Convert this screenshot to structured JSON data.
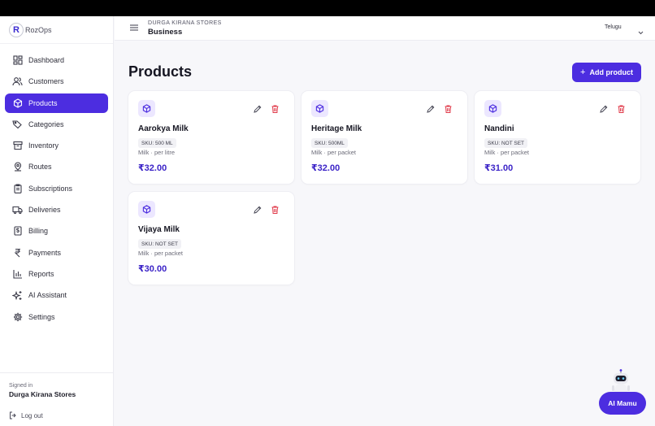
{
  "brand": {
    "name": "RozOps",
    "logo_letter": "R"
  },
  "sidebar": {
    "items": [
      {
        "label": "Dashboard",
        "icon": "dashboard-icon",
        "active": false
      },
      {
        "label": "Customers",
        "icon": "users-icon",
        "active": false
      },
      {
        "label": "Products",
        "icon": "box-icon",
        "active": true
      },
      {
        "label": "Categories",
        "icon": "tag-icon",
        "active": false
      },
      {
        "label": "Inventory",
        "icon": "archive-icon",
        "active": false
      },
      {
        "label": "Routes",
        "icon": "map-pin-icon",
        "active": false
      },
      {
        "label": "Subscriptions",
        "icon": "clipboard-icon",
        "active": false
      },
      {
        "label": "Deliveries",
        "icon": "truck-icon",
        "active": false
      },
      {
        "label": "Billing",
        "icon": "receipt-icon",
        "active": false
      },
      {
        "label": "Payments",
        "icon": "rupee-icon",
        "active": false
      },
      {
        "label": "Reports",
        "icon": "bar-chart-icon",
        "active": false
      },
      {
        "label": "AI Assistant",
        "icon": "sparkle-icon",
        "active": false
      },
      {
        "label": "Settings",
        "icon": "gear-icon",
        "active": false
      }
    ],
    "signed_in_label": "Signed in",
    "signed_in_name": "Durga Kirana Stores",
    "logout_label": "Log out"
  },
  "header": {
    "store_name": "DURGA KIRANA STORES",
    "store_type": "Business",
    "language": "Telugu"
  },
  "main": {
    "title": "Products",
    "add_button": "Add product",
    "products": [
      {
        "name": "Aarokya Milk",
        "sku": "SKU: 500 ML",
        "meta": "Milk · per litre",
        "price": "₹32.00"
      },
      {
        "name": "Heritage Milk",
        "sku": "SKU: 500ML",
        "meta": "Milk · per packet",
        "price": "₹32.00"
      },
      {
        "name": "Nandini",
        "sku": "SKU: NOT SET",
        "meta": "Milk · per packet",
        "price": "₹31.00"
      },
      {
        "name": "Vijaya Milk",
        "sku": "SKU: NOT SET",
        "meta": "Milk · per packet",
        "price": "₹30.00"
      }
    ]
  },
  "assistant": {
    "label": "AI Mamu"
  },
  "colors": {
    "accent": "#4c2de0",
    "price": "#3b23c7",
    "danger": "#e03a4a"
  }
}
